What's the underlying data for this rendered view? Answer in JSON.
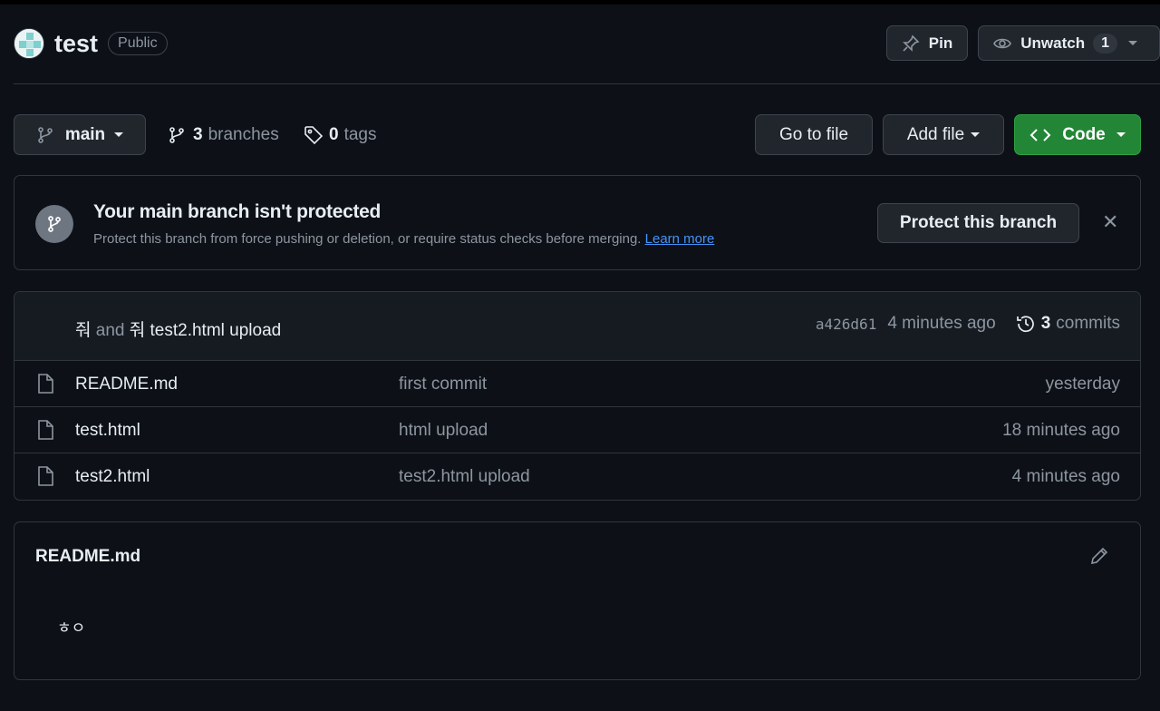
{
  "repo": {
    "name": "test",
    "visibility": "Public",
    "pin_label": "Pin",
    "watch_label": "Unwatch",
    "watch_count": "1"
  },
  "toolbar": {
    "branch": "main",
    "branches_count": "3",
    "branches_label": "branches",
    "tags_count": "0",
    "tags_label": "tags",
    "goto_file": "Go to file",
    "add_file": "Add file",
    "code": "Code"
  },
  "banner": {
    "title": "Your main branch isn't protected",
    "description": "Protect this branch from force pushing or deletion, or require status checks before merging.",
    "learn_more": "Learn more",
    "button": "Protect this branch",
    "close": "✕"
  },
  "latest_commit": {
    "author1": "줘",
    "and": "and",
    "author2": "줘",
    "message": "test2.html upload",
    "sha": "a426d61",
    "age": "4 minutes ago",
    "commits_count": "3",
    "commits_label": "commits"
  },
  "files": [
    {
      "name": "README.md",
      "commit": "first commit",
      "age": "yesterday"
    },
    {
      "name": "test.html",
      "commit": "html upload",
      "age": "18 minutes ago"
    },
    {
      "name": "test2.html",
      "commit": "test2.html upload",
      "age": "4 minutes ago"
    }
  ],
  "readme": {
    "title": "README.md",
    "body": "ㅎㅇ"
  },
  "colors": {
    "background": "#0d1117",
    "border": "#30363d",
    "accent_green": "#238636",
    "link": "#4493f8",
    "muted_text": "#8d96a0"
  },
  "icons": {
    "avatar": "identicon-avatar",
    "pin": "pin-icon",
    "watch": "eye-icon",
    "branch": "git-branch-icon",
    "tag": "tag-icon",
    "code": "code-icon",
    "history": "history-icon",
    "file": "file-icon",
    "edit": "pencil-icon",
    "close": "close-icon"
  }
}
